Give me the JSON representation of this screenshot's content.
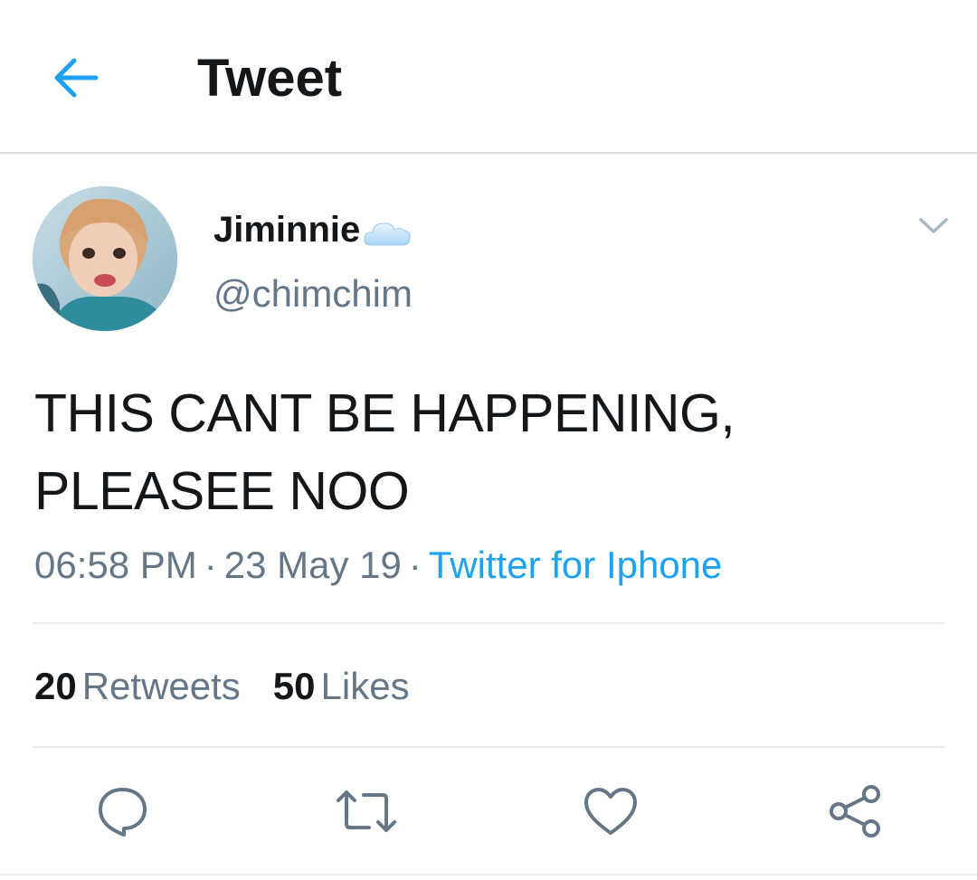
{
  "header": {
    "title": "Tweet"
  },
  "tweet": {
    "author": {
      "display_name": "Jiminnie",
      "handle": "@chimchim"
    },
    "text_lines": [
      "THIS CANT BE HAPPENING,",
      "PLEASEE NOO"
    ],
    "time": "06:58 PM",
    "date": "23 May 19",
    "source": "Twitter for Iphone",
    "separator": "·",
    "stats": {
      "retweets_count": "20",
      "retweets_label": "Retweets",
      "likes_count": "50",
      "likes_label": "Likes"
    }
  },
  "icons": {
    "back": "arrow-left-icon",
    "caret": "chevron-down-icon",
    "reply": "reply-icon",
    "retweet": "retweet-icon",
    "like": "heart-icon",
    "share": "share-icon",
    "emoji": "cloud-emoji-icon"
  },
  "colors": {
    "accent": "#1da1f2",
    "text": "#14171a",
    "secondary_text": "#657786",
    "divider": "#e6ecf0"
  }
}
